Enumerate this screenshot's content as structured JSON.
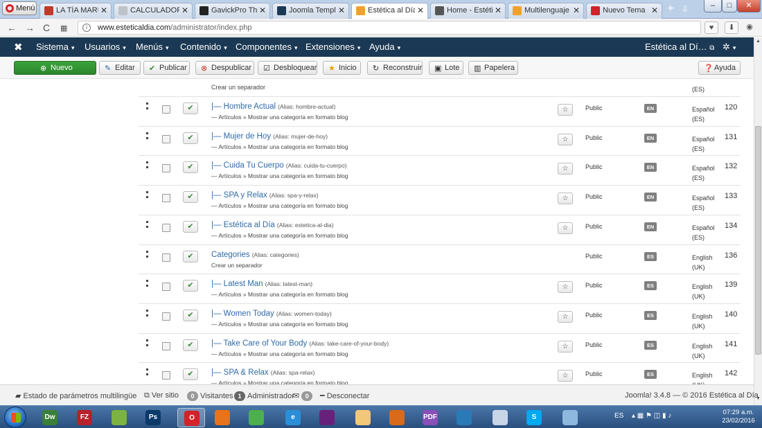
{
  "browser": {
    "menu_label": "Menú",
    "tabs": [
      {
        "label": "LA TÍA MARUJA",
        "color": "#c0392b"
      },
      {
        "label": "CALCULADORA",
        "color": "#bdc3c7"
      },
      {
        "label": "GavickPro Them",
        "color": "#222222"
      },
      {
        "label": "Joomla Templat",
        "color": "#1b3954"
      },
      {
        "label": "Estética al Día -",
        "color": "#f0a030"
      },
      {
        "label": "Home - Estética",
        "color": "#555555"
      },
      {
        "label": "Multilenguaje y",
        "color": "#f0a030"
      },
      {
        "label": "Nuevo Tema",
        "color": "#d0242a"
      }
    ],
    "active_tab_index": 4,
    "close_glyph": "✕",
    "new_tab_glyph": "+",
    "tab_menu_glyph": "⇩",
    "url_host": "www.esteticaldia.com",
    "url_path": "/administrator/index.php"
  },
  "navbar": {
    "logo_glyph": "✖",
    "items": [
      "Sistema",
      "Usuarios",
      "Menús",
      "Contenido",
      "Componentes",
      "Extensiones",
      "Ayuda"
    ],
    "site_label": "Estética al Dí…",
    "caret_glyph": "▾",
    "gear_glyph": "✲"
  },
  "toolbar": {
    "new": "Nuevo",
    "edit": "Editar",
    "publish": "Publicar",
    "unpublish": "Despublicar",
    "unlock": "Desbloquear",
    "home": "Inicio",
    "rebuild": "Reconstruir",
    "batch": "Lote",
    "trash": "Papelera",
    "help": "Ayuda"
  },
  "top_partial": {
    "sub": "Crear un separador",
    "lang_line": "(ES)"
  },
  "rows": [
    {
      "title": "|— Hombre Actual",
      "alias": "(Alias: hombre-actual)",
      "sub": "— Artículos » Mostrar una categoría en formato blog",
      "home": true,
      "access": "Public",
      "lang": "EN",
      "lang_name": "Español",
      "lang_region": "(ES)",
      "id": "120"
    },
    {
      "title": "|— Mujer de Hoy",
      "alias": "(Alias: mujer-de-hoy)",
      "sub": "— Artículos » Mostrar una categoría en formato blog",
      "home": true,
      "access": "Public",
      "lang": "EN",
      "lang_name": "Español",
      "lang_region": "(ES)",
      "id": "131"
    },
    {
      "title": "|— Cuida Tu Cuerpo",
      "alias": "(Alias: cuida-tu-cuerpo)",
      "sub": "— Artículos » Mostrar una categoría en formato blog",
      "home": true,
      "access": "Public",
      "lang": "EN",
      "lang_name": "Español",
      "lang_region": "(ES)",
      "id": "132"
    },
    {
      "title": "|— SPA y Relax",
      "alias": "(Alias: spa-y-relax)",
      "sub": "— Artículos » Mostrar una categoría en formato blog",
      "home": true,
      "access": "Public",
      "lang": "EN",
      "lang_name": "Español",
      "lang_region": "(ES)",
      "id": "133"
    },
    {
      "title": "|— Estética al Día",
      "alias": "(Alias: estetica-al-dia)",
      "sub": "— Artículos » Mostrar una categoría en formato blog",
      "home": true,
      "access": "Public",
      "lang": "EN",
      "lang_name": "Español",
      "lang_region": "(ES)",
      "id": "134"
    },
    {
      "title": "Categories",
      "alias": "(Alias: categories)",
      "sub": "Crear un separador",
      "home": false,
      "access": "Public",
      "lang": "ES",
      "lang_name": "English",
      "lang_region": "(UK)",
      "id": "136"
    },
    {
      "title": "|— Latest Man",
      "alias": "(Alias: latest-man)",
      "sub": "— Artículos » Mostrar una categoría en formato blog",
      "home": true,
      "access": "Public",
      "lang": "ES",
      "lang_name": "English",
      "lang_region": "(UK)",
      "id": "139"
    },
    {
      "title": "|— Women Today",
      "alias": "(Alias: women-today)",
      "sub": "— Artículos » Mostrar una categoría en formato blog",
      "home": true,
      "access": "Public",
      "lang": "ES",
      "lang_name": "English",
      "lang_region": "(UK)",
      "id": "140"
    },
    {
      "title": "|— Take Care of Your Body",
      "alias": "(Alias: take-care-of-your-body)",
      "sub": "— Artículos » Mostrar una categoría en formato blog",
      "home": true,
      "access": "Public",
      "lang": "ES",
      "lang_name": "English",
      "lang_region": "(UK)",
      "id": "141"
    },
    {
      "title": "|— SPA & Relax",
      "alias": "(Alias: spa-relax)",
      "sub": "— Artículos » Mostrar una categoría en formato blog",
      "home": true,
      "access": "Public",
      "lang": "ES",
      "lang_name": "English",
      "lang_region": "(UK)",
      "id": "142"
    }
  ],
  "row_glyphs": {
    "check": "✔",
    "star": "☆"
  },
  "status": {
    "multilang": "Estado de parámetros multilingüe",
    "view_site": "Ver sitio",
    "visitors_count": "0",
    "visitors": "Visitantes",
    "admins_count": "1",
    "admins": "Administrador",
    "messages_count": "0",
    "logout": "Desconectar",
    "footer": "Joomla! 3.4.8 — © 2016 Estética al Día"
  },
  "taskbar": {
    "apps": [
      {
        "name": "dreamweaver",
        "label": "Dw",
        "color": "#3a7f3a"
      },
      {
        "name": "filezilla",
        "label": "FZ",
        "color": "#b8202a"
      },
      {
        "name": "app3",
        "label": "",
        "color": "#7cb342"
      },
      {
        "name": "photoshop",
        "label": "Ps",
        "color": "#0a3a6a"
      },
      {
        "name": "opera",
        "label": "O",
        "color": "#d0242a"
      },
      {
        "name": "firefox",
        "label": "",
        "color": "#e8731a"
      },
      {
        "name": "chrome",
        "label": "",
        "color": "#4caf50"
      },
      {
        "name": "ie",
        "label": "e",
        "color": "#2a8fd8"
      },
      {
        "name": "visual-studio",
        "label": "",
        "color": "#68217a"
      },
      {
        "name": "notepad",
        "label": "",
        "color": "#f3c77a"
      },
      {
        "name": "app11",
        "label": "",
        "color": "#d86a1a"
      },
      {
        "name": "pdf",
        "label": "PDF",
        "color": "#8a4fb8"
      },
      {
        "name": "app13",
        "label": "",
        "color": "#2a7ab8"
      },
      {
        "name": "app14",
        "label": "",
        "color": "#c9d6e8"
      },
      {
        "name": "skype",
        "label": "S",
        "color": "#00a9f0"
      },
      {
        "name": "paint",
        "label": "",
        "color": "#8fb8de"
      }
    ],
    "lang": "ES",
    "time": "07:29 a.m.",
    "date": "23/02/2016"
  }
}
